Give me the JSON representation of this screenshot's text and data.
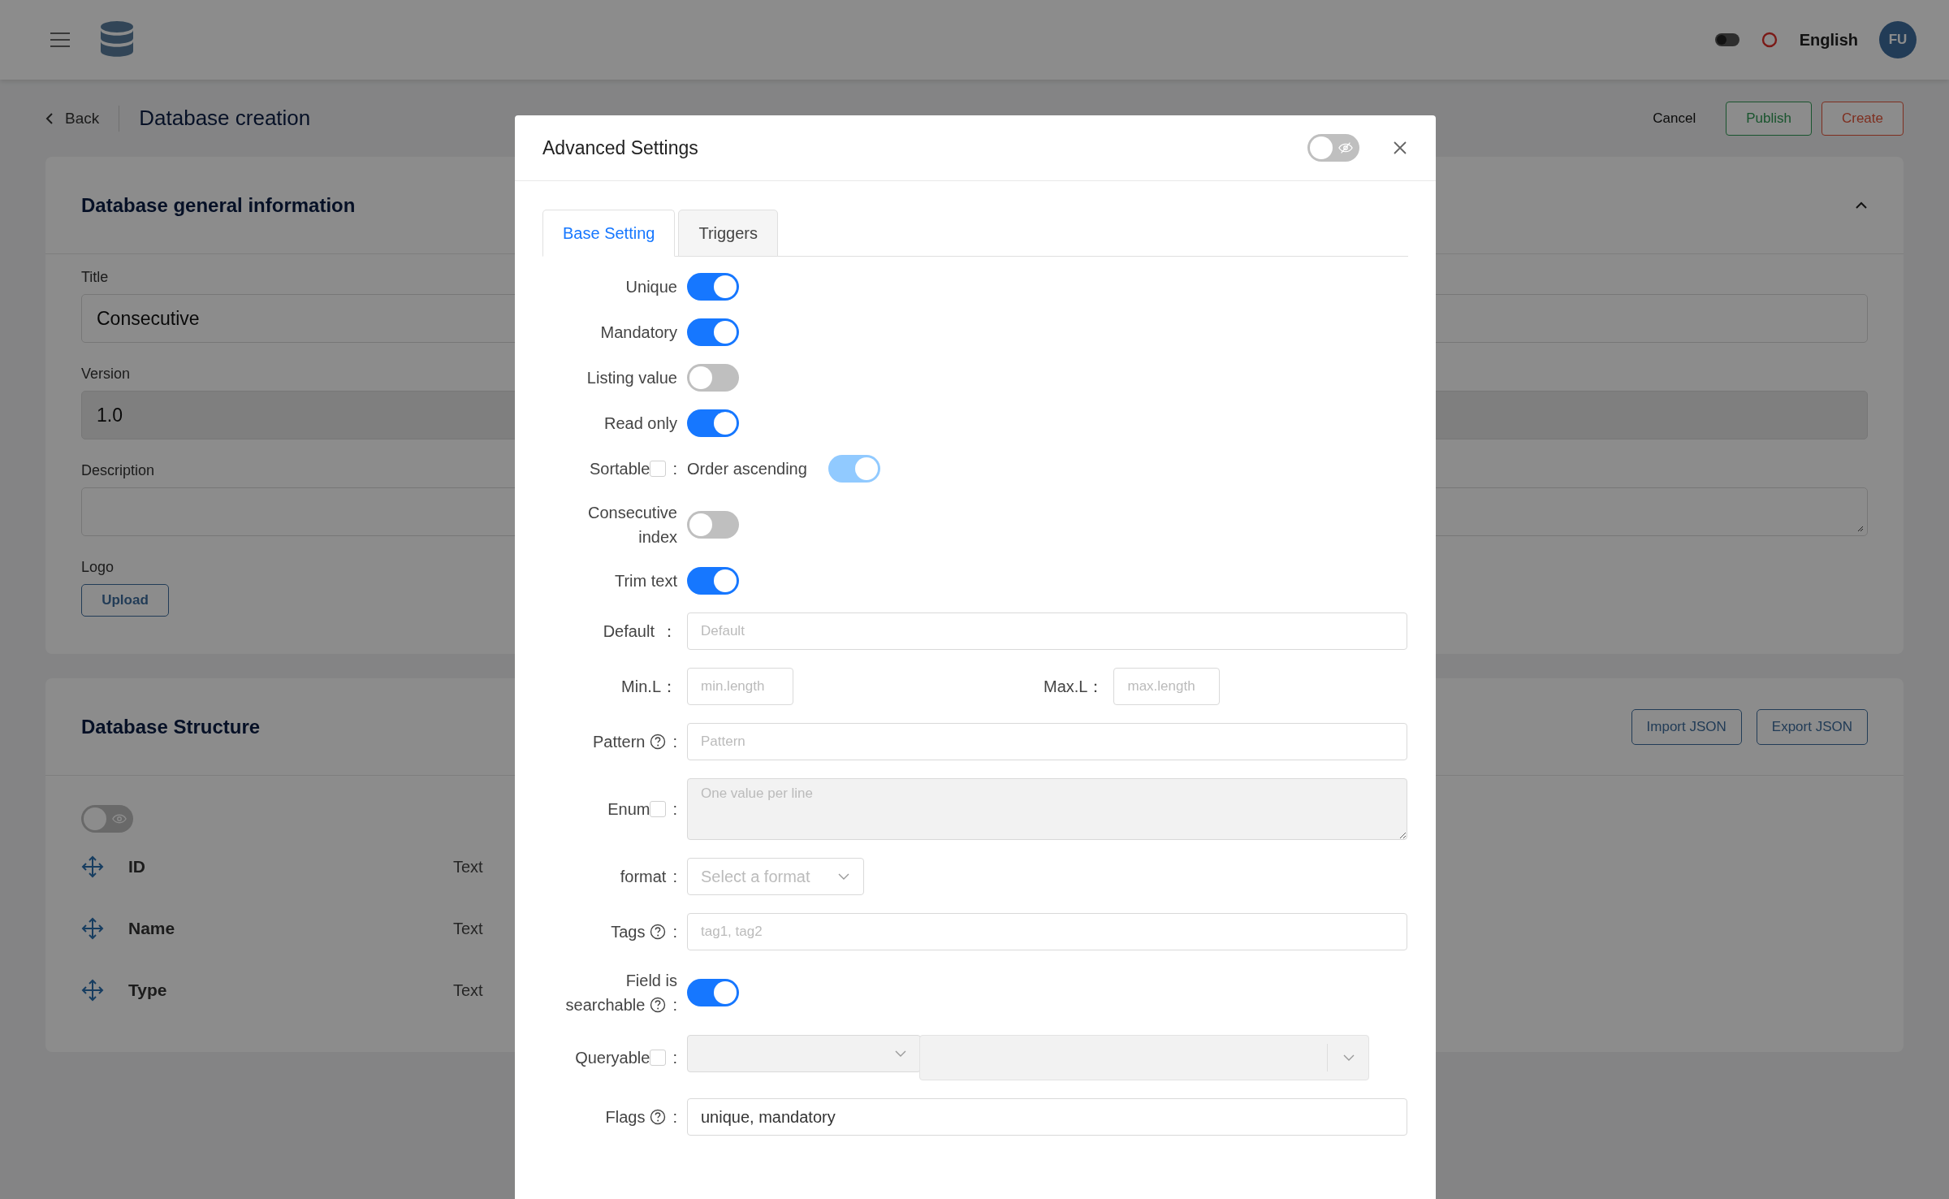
{
  "header": {
    "theme_on": false,
    "language": "English",
    "avatar": "FU"
  },
  "page": {
    "back": "Back",
    "title": "Database creation",
    "actions": [
      {
        "label": "Cancel",
        "kind": "text"
      },
      {
        "label": "Publish",
        "kind": "success"
      },
      {
        "label": "Create",
        "kind": "danger"
      }
    ]
  },
  "general": {
    "title": "Database general information",
    "expanded": true,
    "fields": [
      {
        "kind": "input",
        "label": "Title",
        "value": "Consecutive",
        "disabled": false
      },
      {
        "kind": "input",
        "label": "Version",
        "value": "1.0",
        "disabled": true
      },
      {
        "kind": "textarea",
        "label": "Description"
      }
    ],
    "logo": {
      "label": "Logo",
      "button": "Upload"
    }
  },
  "structure": {
    "title": "Database Structure",
    "buttons": [
      "Import JSON",
      "Export JSON"
    ],
    "preview_on": false,
    "fields": [
      {
        "name": "ID",
        "type": "Text"
      },
      {
        "name": "Name",
        "type": "Text"
      },
      {
        "name": "Type",
        "type": "Text"
      }
    ]
  },
  "modal": {
    "title": "Advanced Settings",
    "preview_on": false,
    "tabs": [
      {
        "label": "Base Setting",
        "selected": true
      },
      {
        "label": "Triggers",
        "selected": false
      }
    ],
    "rows": [
      {
        "kind": "toggle",
        "label": "Unique",
        "on": true
      },
      {
        "kind": "toggle",
        "label": "Mandatory",
        "on": true
      },
      {
        "kind": "toggle",
        "label": "Listing value",
        "on": false
      },
      {
        "kind": "toggle",
        "label": "Read only",
        "on": true
      },
      {
        "kind": "sortable",
        "label": "Sortable",
        "checked": false,
        "colon": ":",
        "option": "Order ascending",
        "on": true,
        "disabled": true
      },
      {
        "kind": "toggle",
        "label": "Consecutive index",
        "on": false
      },
      {
        "kind": "toggle",
        "label": "Trim text",
        "on": true
      },
      {
        "kind": "input",
        "label": "Default",
        "colon": "：",
        "placeholder": "Default"
      },
      {
        "kind": "pair",
        "fields": [
          {
            "label": "Min.L",
            "colon": "：",
            "placeholder": "min.length"
          },
          {
            "label": "Max.L",
            "colon": "：",
            "placeholder": "max.length"
          }
        ]
      },
      {
        "kind": "input",
        "label": "Pattern",
        "help": true,
        "colon": ":",
        "placeholder": "Pattern"
      },
      {
        "kind": "textarea",
        "label": "Enum",
        "checked": false,
        "colon": ":",
        "placeholder": "One value per line",
        "disabled": true
      },
      {
        "kind": "select",
        "label": "format",
        "colon": ":",
        "placeholder": "Select a format"
      },
      {
        "kind": "input",
        "label": "Tags",
        "help": true,
        "colon": ":",
        "placeholder": "tag1, tag2"
      },
      {
        "kind": "toggle",
        "label": "Field is searchable",
        "help": true,
        "colon": ":",
        "on": true
      },
      {
        "kind": "query",
        "label": "Queryable",
        "checked": false,
        "colon": ":",
        "disabled": true
      },
      {
        "kind": "input",
        "label": "Flags",
        "help": true,
        "colon": ":",
        "value": "unique, mandatory"
      }
    ]
  }
}
